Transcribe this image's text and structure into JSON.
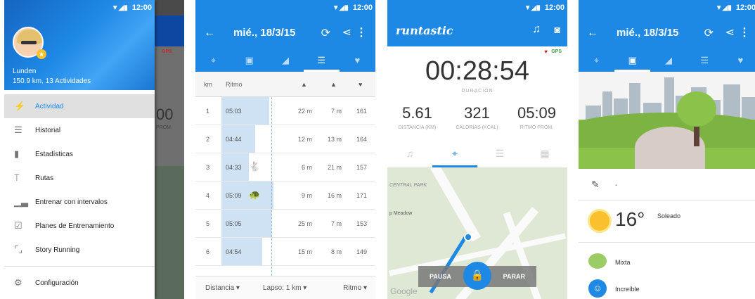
{
  "status": {
    "icons": "▼◢▮",
    "time": "12:00"
  },
  "screen1": {
    "user_name": "Lunden",
    "user_stats": "150.9 km, 13 Actividades",
    "menu": [
      {
        "label": "Actividad",
        "icon": "runner-icon",
        "glyph": "⚡"
      },
      {
        "label": "Historial",
        "icon": "list-icon",
        "glyph": "☰"
      },
      {
        "label": "Estadísticas",
        "icon": "bar-chart-icon",
        "glyph": "▮"
      },
      {
        "label": "Rutas",
        "icon": "signpost-icon",
        "glyph": "⍑"
      },
      {
        "label": "Entrenar con intervalos",
        "icon": "interval-icon",
        "glyph": "▁▃"
      },
      {
        "label": "Planes de Entrenamiento",
        "icon": "checklist-icon",
        "glyph": "☑"
      },
      {
        "label": "Story Running",
        "icon": "story-icon",
        "glyph": "⌜⌟"
      },
      {
        "label": "Configuración",
        "icon": "gear-icon",
        "glyph": "⚙"
      }
    ],
    "behind_value": "00",
    "behind_label": "PROM.",
    "behind_gps": "GPS"
  },
  "screen2": {
    "title": "mié., 18/3/15",
    "columns": {
      "km": "km",
      "pace": "Ritmo"
    },
    "rows": [
      {
        "km": "1",
        "pace": "05:03",
        "bar": 0.42,
        "animal": "",
        "elev_up": "22 m",
        "elev_down": "7 m",
        "hr": "161"
      },
      {
        "km": "2",
        "pace": "04:44",
        "bar": 0.3,
        "animal": "",
        "elev_up": "12 m",
        "elev_down": "13 m",
        "hr": "164"
      },
      {
        "km": "3",
        "pace": "04:33",
        "bar": 0.24,
        "animal": "🐇",
        "elev_up": "6 m",
        "elev_down": "21 m",
        "hr": "157"
      },
      {
        "km": "4",
        "pace": "05:09",
        "bar": 0.46,
        "animal": "🐢",
        "elev_up": "9 m",
        "elev_down": "16 m",
        "hr": "171"
      },
      {
        "km": "5",
        "pace": "05:05",
        "bar": 0.44,
        "animal": "",
        "elev_up": "25 m",
        "elev_down": "7 m",
        "hr": "153"
      },
      {
        "km": "6",
        "pace": "04:54",
        "bar": 0.36,
        "animal": "",
        "elev_up": "15 m",
        "elev_down": "8 m",
        "hr": "149"
      }
    ],
    "footer": {
      "distance": "Distancia ▾",
      "lap": "Lapso: 1 km ▾",
      "pace": "Ritmo ▾"
    }
  },
  "screen3": {
    "logo": "runtastic",
    "gps": "GPS",
    "time": "00:28:54",
    "duration_label": "DURACIÓN",
    "stats": [
      {
        "value": "5.61",
        "label": "DISTANCIA (KM)"
      },
      {
        "value": "321",
        "label": "CALORÍAS (KCAL)"
      },
      {
        "value": "05:09",
        "label": "RITMO PROM."
      }
    ],
    "map": {
      "park": "CENTRAL PARK",
      "meadow": "p Meadow",
      "google": "Google"
    },
    "pause": "PAUSA",
    "stop": "PARAR"
  },
  "screen4": {
    "title": "mié., 18/3/15",
    "note": "-",
    "temperature": "16°",
    "weather": "Soleado",
    "surface": "Mixta",
    "feeling": "Increíble"
  }
}
